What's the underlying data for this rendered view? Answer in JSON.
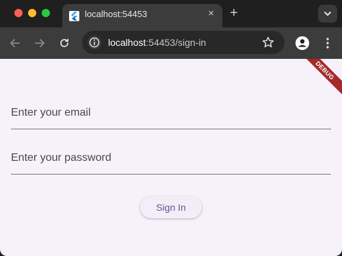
{
  "browser": {
    "tab": {
      "title": "localhost:54453",
      "close_glyph": "×"
    },
    "new_tab_glyph": "+",
    "address": {
      "host": "localhost",
      "rest": ":54453/sign-in"
    }
  },
  "page": {
    "email_placeholder": "Enter your email",
    "password_placeholder": "Enter your password",
    "signin_label": "Sign In",
    "debug_banner": "DEBUG"
  },
  "colors": {
    "page_bg": "#f7f2fa",
    "button_text": "#65558f",
    "debug_ribbon": "#a52a2a"
  },
  "icons": [
    "back-icon",
    "forward-icon",
    "reload-icon",
    "site-info-icon",
    "bookmark-star-icon",
    "profile-icon",
    "menu-icon",
    "tab-search-icon",
    "flutter-favicon"
  ]
}
